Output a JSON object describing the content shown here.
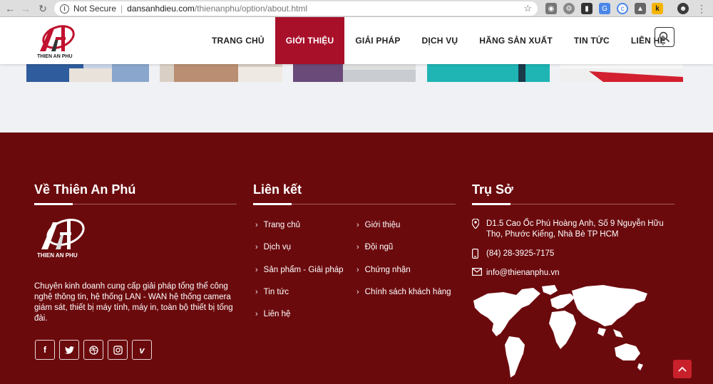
{
  "browser": {
    "security_label": "Not Secure",
    "url_domain": "dansanhdieu.com",
    "url_path": "/thienanphu/option/about.html"
  },
  "header": {
    "logo_text": "THIEN AN PHU",
    "nav": [
      {
        "label": "TRANG CHỦ",
        "active": false
      },
      {
        "label": "GIỚI THIỆU",
        "active": true
      },
      {
        "label": "GIẢI PHÁP",
        "active": false
      },
      {
        "label": "DỊCH VỤ",
        "active": false
      },
      {
        "label": "HÃNG SẢN XUẤT",
        "active": false
      },
      {
        "label": "TIN TỨC",
        "active": false
      },
      {
        "label": "LIÊN HỆ",
        "active": false
      }
    ]
  },
  "footer": {
    "about": {
      "title": "Về Thiên An Phú",
      "logo_text": "THIEN AN PHU",
      "description": "Chuyên kinh doanh cung cấp giải pháp tổng thể công nghệ thông tin, hệ thống LAN - WAN hệ thống camera giám sát, thiết bị máy tính, máy in, toàn bộ thiết bị tổng đài.",
      "social": [
        "facebook-icon",
        "twitter-icon",
        "dribbble-icon",
        "instagram-icon",
        "vimeo-icon"
      ]
    },
    "links": {
      "title": "Liên kết",
      "col1": [
        "Trang chủ",
        "Dịch vụ",
        "Sản phẩm - Giải pháp",
        "Tin tức",
        "Liên hệ"
      ],
      "col2": [
        "Giới thiệu",
        "Đội ngũ",
        "Chứng nhận",
        "Chính sách khách hàng"
      ]
    },
    "office": {
      "title": "Trụ Sở",
      "address": "D1.5 Cao Ốc Phú Hoàng Anh, Số 9 Nguyễn Hữu Thọ, Phước Kiểng, Nhà Bè TP HCM",
      "phone": "(84) 28-3925-7175",
      "email": "info@thienanphu.vn"
    }
  },
  "colors": {
    "brand": "#a8102a",
    "footer_bg": "#6b0a0d",
    "scroll_top": "#c9212c"
  }
}
